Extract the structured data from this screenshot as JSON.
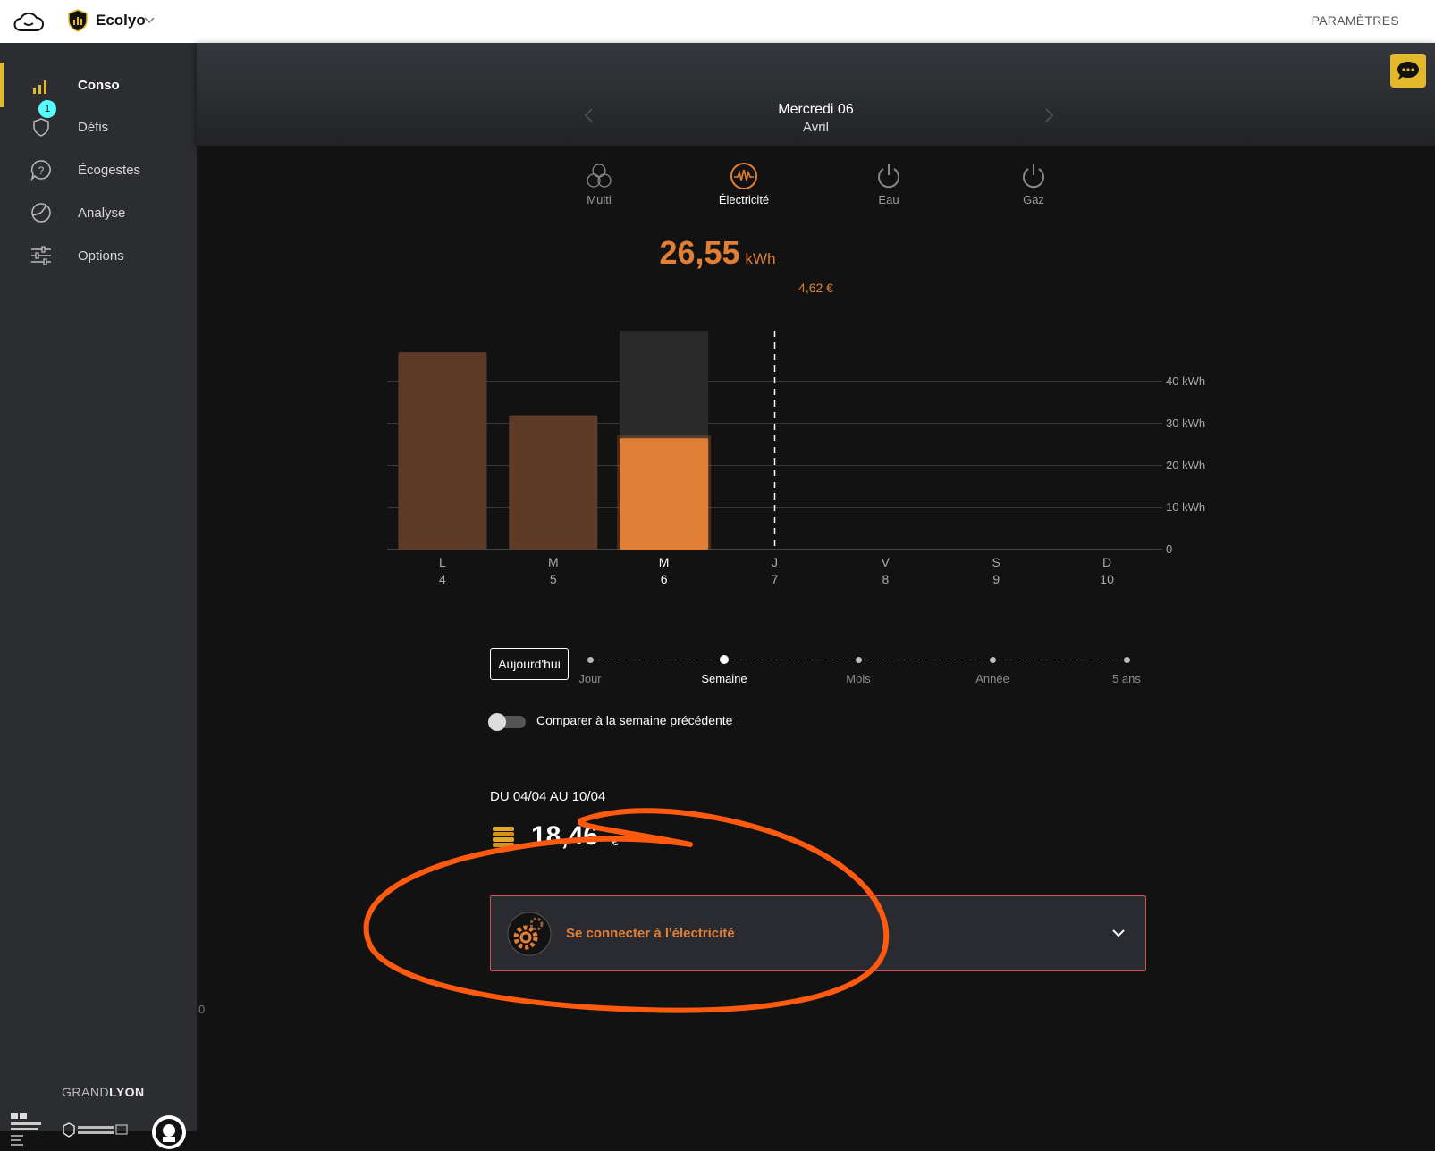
{
  "topbar": {
    "app_name": "Ecolyo",
    "settings_label": "PARAMÈTRES"
  },
  "sidebar": {
    "items": [
      {
        "label": "Conso",
        "icon": "bar-chart-icon",
        "active": true
      },
      {
        "label": "Défis",
        "icon": "shield-icon",
        "badge": "1"
      },
      {
        "label": "Écogestes",
        "icon": "question-bubble-icon"
      },
      {
        "label": "Analyse",
        "icon": "pie-chart-icon"
      },
      {
        "label": "Options",
        "icon": "sliders-icon"
      }
    ],
    "footer": {
      "grandlyon_a": "GRAND",
      "grandlyon_b": "LYON"
    }
  },
  "header": {
    "day": "Mercredi 06",
    "month": "Avril"
  },
  "fluids": [
    {
      "label": "Multi",
      "icon": "multi-fluid-icon"
    },
    {
      "label": "Électricité",
      "icon": "electricity-icon",
      "active": true
    },
    {
      "label": "Eau",
      "icon": "water-power-icon"
    },
    {
      "label": "Gaz",
      "icon": "gas-power-icon"
    }
  ],
  "consumption": {
    "value": "26,55",
    "unit": "kWh",
    "price": "4,62 €"
  },
  "colors": {
    "accent": "#e27f36",
    "bar_past": "#5e3b28",
    "bar_selected": "#e27f36",
    "sidebar_active": "#e3b82a",
    "badge": "#58ffff"
  },
  "chart_data": {
    "type": "bar",
    "categories": [
      "L\n4",
      "M\n5",
      "M\n6",
      "J\n7",
      "V\n8",
      "S\n9",
      "D\n10"
    ],
    "day_letters": [
      "L",
      "M",
      "M",
      "J",
      "V",
      "S",
      "D"
    ],
    "day_numbers": [
      "4",
      "5",
      "6",
      "7",
      "8",
      "9",
      "10"
    ],
    "values": [
      47,
      32,
      26.55,
      null,
      null,
      null,
      null
    ],
    "selected_index": 2,
    "today_index": 3,
    "ylim": [
      0,
      50
    ],
    "yticks": [
      0,
      10,
      20,
      30,
      40
    ],
    "ytick_labels": [
      "0",
      "10 kWh",
      "20 kWh",
      "30 kWh",
      "40 kWh"
    ],
    "grid": true
  },
  "period": {
    "today_label": "Aujourd'hui",
    "options": [
      "Jour",
      "Semaine",
      "Mois",
      "Année",
      "5 ans"
    ],
    "active_index": 1
  },
  "compare": {
    "label": "Comparer à la semaine précédente"
  },
  "summary": {
    "range": "DU 04/04 AU 10/04",
    "total": "18,46",
    "currency": "€"
  },
  "connect": {
    "label": "Se connecter à l'électricité"
  },
  "stray_text": "0"
}
